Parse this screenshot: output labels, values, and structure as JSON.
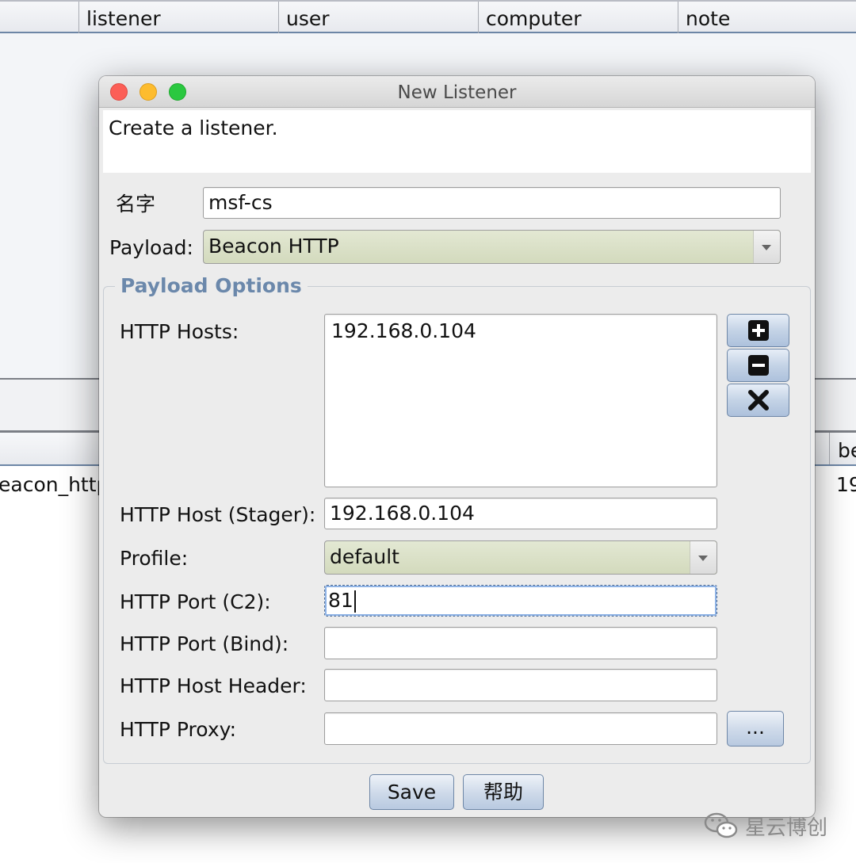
{
  "background": {
    "table_headers": [
      "",
      "listener",
      "user",
      "computer",
      "note"
    ],
    "lower_header_right": "be",
    "lower_row_left": "eacon_http",
    "lower_row_right": "19"
  },
  "dialog": {
    "title": "New Listener",
    "description": "Create a listener.",
    "name_label": "名字",
    "name_value": "msf-cs",
    "payload_label": "Payload:",
    "payload_value": "Beacon HTTP",
    "group_title": "Payload Options",
    "http_hosts_label": "HTTP Hosts:",
    "http_hosts_items": [
      "192.168.0.104"
    ],
    "stager_label": "HTTP Host (Stager):",
    "stager_value": "192.168.0.104",
    "profile_label": "Profile:",
    "profile_value": "default",
    "port_c2_label": "HTTP Port (C2):",
    "port_c2_value": "81",
    "port_bind_label": "HTTP Port (Bind):",
    "port_bind_value": "",
    "host_header_label": "HTTP Host Header:",
    "host_header_value": "",
    "proxy_label": "HTTP Proxy:",
    "proxy_value": "",
    "proxy_button_label": "...",
    "save_label": "Save",
    "help_label": "帮助"
  },
  "icons": {
    "add": "plus-square-icon",
    "remove": "minus-square-icon",
    "clear": "x-icon",
    "watermark": "wechat-icon"
  },
  "watermark_text": "星云博创"
}
